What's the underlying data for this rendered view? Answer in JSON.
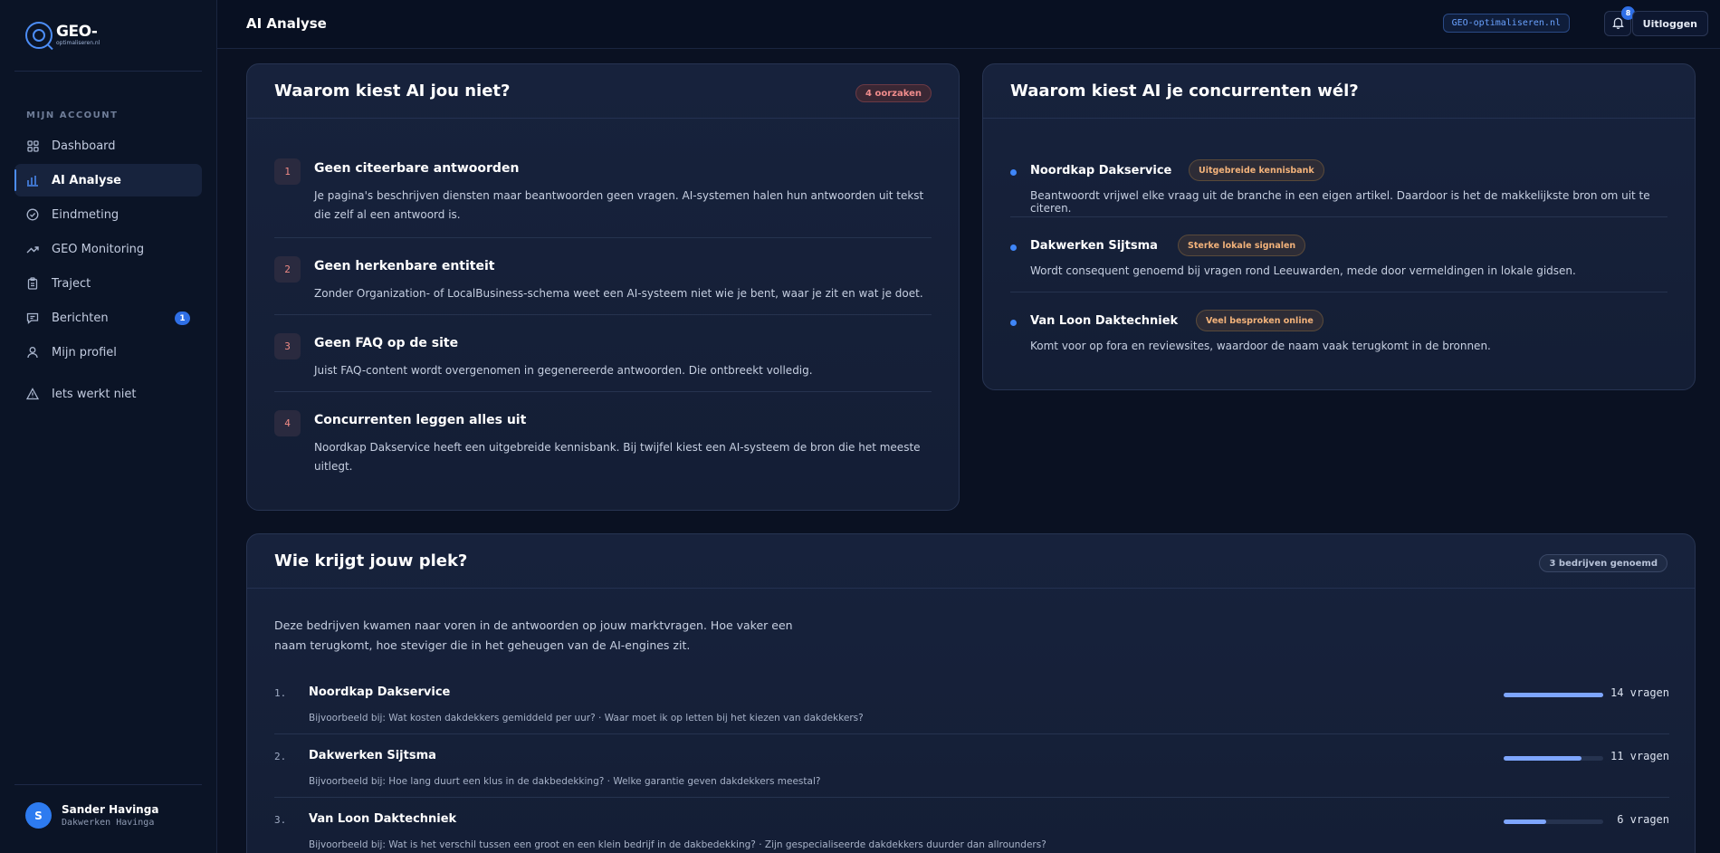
{
  "brand": {
    "name": "GEO-",
    "sub": "optimaliseren.nl"
  },
  "sidebar": {
    "section_label": "MIJN ACCOUNT",
    "items": [
      {
        "label": "Dashboard"
      },
      {
        "label": "AI Analyse"
      },
      {
        "label": "Eindmeting"
      },
      {
        "label": "GEO Monitoring"
      },
      {
        "label": "Traject"
      },
      {
        "label": "Berichten",
        "badge": "1"
      },
      {
        "label": "Mijn profiel"
      },
      {
        "label": "Iets werkt niet"
      }
    ],
    "user": {
      "initial": "S",
      "name": "Sander Havinga",
      "company": "Dakwerken Havinga"
    }
  },
  "header": {
    "title": "AI Analyse",
    "domain": "GEO-optimaliseren.nl",
    "notifications": "8",
    "logout": "Uitloggen"
  },
  "why_not": {
    "title": "Waarom kiest AI jou niet?",
    "badge": "4 oorzaken",
    "reasons": [
      {
        "num": "1",
        "title": "Geen citeerbare antwoorden",
        "desc": "Je pagina's beschrijven diensten maar beantwoorden geen vragen. AI-systemen halen hun antwoorden uit tekst die zelf al een antwoord is."
      },
      {
        "num": "2",
        "title": "Geen herkenbare entiteit",
        "desc": "Zonder Organization- of LocalBusiness-schema weet een AI-systeem niet wie je bent, waar je zit en wat je doet."
      },
      {
        "num": "3",
        "title": "Geen FAQ op de site",
        "desc": "Juist FAQ-content wordt overgenomen in gegenereerde antwoorden. Die ontbreekt volledig."
      },
      {
        "num": "4",
        "title": "Concurrenten leggen alles uit",
        "desc": "Noordkap Dakservice heeft een uitgebreide kennisbank. Bij twijfel kiest een AI-systeem de bron die het meeste uitlegt."
      }
    ]
  },
  "why_competitors": {
    "title": "Waarom kiest AI je concurrenten wél?",
    "items": [
      {
        "name": "Noordkap Dakservice",
        "tag": "Uitgebreide kennisbank",
        "desc": "Beantwoordt vrijwel elke vraag uit de branche in een eigen artikel. Daardoor is het de makkelijkste bron om uit te citeren."
      },
      {
        "name": "Dakwerken Sijtsma",
        "tag": "Sterke lokale signalen",
        "desc": "Wordt consequent genoemd bij vragen rond Leeuwarden, mede door vermeldingen in lokale gidsen."
      },
      {
        "name": "Van Loon Daktechniek",
        "tag": "Veel besproken online",
        "desc": "Komt voor op fora en reviewsites, waardoor de naam vaak terugkomt in de bronnen."
      }
    ]
  },
  "your_spot": {
    "title": "Wie krijgt jouw plek?",
    "badge": "3 bedrijven genoemd",
    "intro": "Deze bedrijven kwamen naar voren in de antwoorden op jouw marktvragen. Hoe vaker een naam terugkomt, hoe steviger die in het geheugen van de AI-engines zit.",
    "max_questions": 14,
    "rows": [
      {
        "num": "1.",
        "name": "Noordkap Dakservice",
        "example": "Bijvoorbeeld bij: Wat kosten dakdekkers gemiddeld per uur? · Waar moet ik op letten bij het kiezen van dakdekkers?",
        "questions": 14,
        "count_label": "14 vragen"
      },
      {
        "num": "2.",
        "name": "Dakwerken Sijtsma",
        "example": "Bijvoorbeeld bij: Hoe lang duurt een klus in de dakbedekking? · Welke garantie geven dakdekkers meestal?",
        "questions": 11,
        "count_label": "11 vragen"
      },
      {
        "num": "3.",
        "name": "Van Loon Daktechniek",
        "example": "Bijvoorbeeld bij: Wat is het verschil tussen een groot en een klein bedrijf in de dakbedekking? · Zijn gespecialiseerde dakdekkers duurder dan allrounders?",
        "questions": 6,
        "count_label": "6 vragen"
      }
    ]
  }
}
